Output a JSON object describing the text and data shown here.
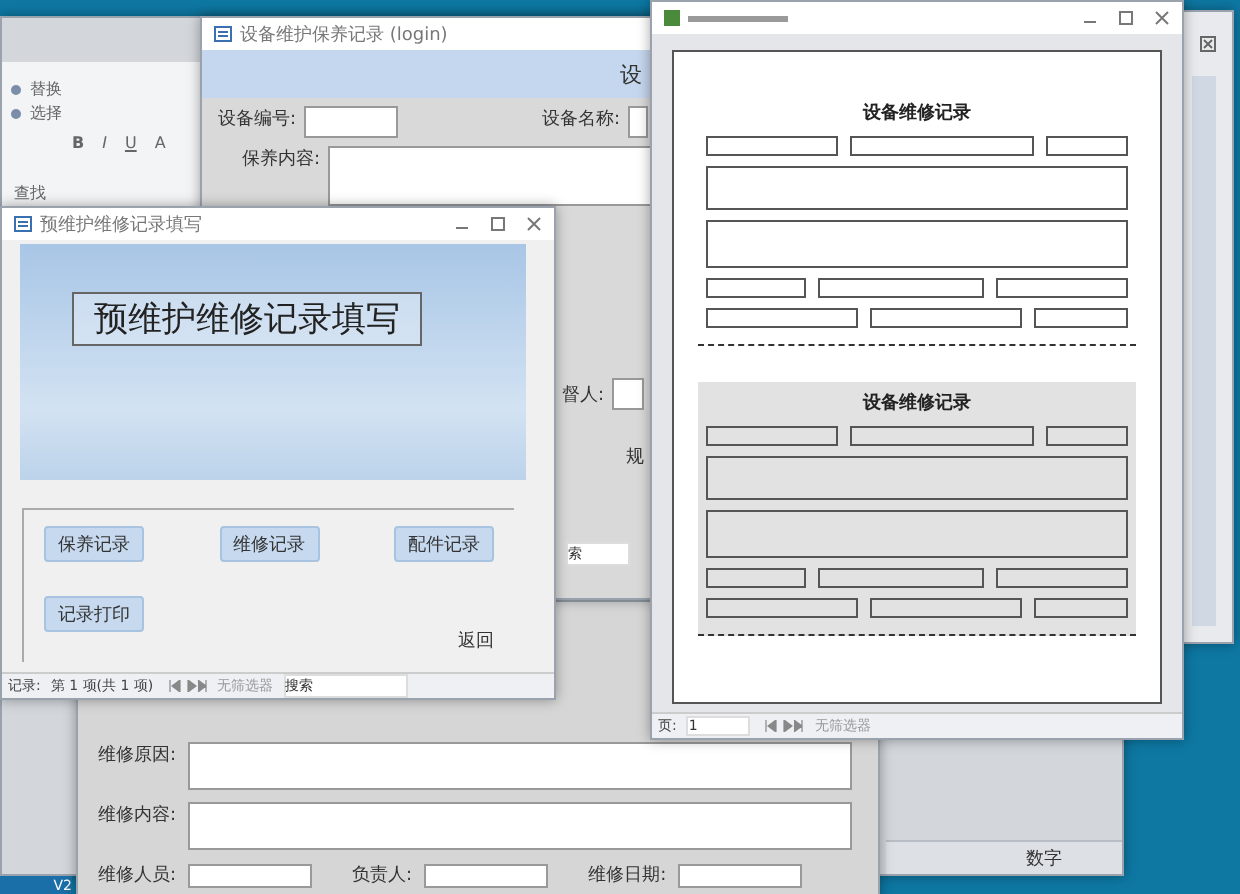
{
  "ribbon": {
    "commands": [
      {
        "label": "替换"
      },
      {
        "label": "选择"
      }
    ],
    "format_buttons": [
      "B",
      "I",
      "U",
      "A"
    ],
    "group_label": "查找"
  },
  "maintenance_form": {
    "title": "设备维护保养记录 (login)",
    "header_text": "设",
    "fields": [
      {
        "label": "设备编号:",
        "kind": "input"
      },
      {
        "label": "设备名称:",
        "kind": "input"
      },
      {
        "label": "保养内容:",
        "kind": "textarea"
      }
    ],
    "fragments": [
      {
        "text": "督人:",
        "kind": "label_input"
      },
      {
        "text": "规",
        "kind": "label"
      },
      {
        "text": "索",
        "kind": "search"
      }
    ]
  },
  "repair_form": {
    "fields": [
      {
        "label": "维修原因:"
      },
      {
        "label": "维修内容:"
      }
    ],
    "bottom_fields": [
      {
        "label": "维修人员:"
      },
      {
        "label": "负责人:"
      },
      {
        "label": "维修日期:"
      }
    ]
  },
  "menu_window": {
    "title": "预维护维修记录填写",
    "banner_title": "预维护维修记录填写",
    "buttons": [
      "保养记录",
      "维修记录",
      "配件记录",
      "记录打印"
    ],
    "back_link": "返回",
    "nav": {
      "label": "记录:",
      "position": "第 1 项(共 1 项)",
      "filter": "无筛选器",
      "search": "搜索"
    }
  },
  "report_window": {
    "pages": [
      {
        "title": "设备维修记录",
        "shaded": false
      },
      {
        "title": "设备维修记录",
        "shaded": true
      }
    ],
    "nav": {
      "label": "页:",
      "page": "1",
      "filter": "无筛选器"
    }
  },
  "status_bar": {
    "mode": "数字"
  },
  "taskbar": {
    "label": "V2"
  }
}
